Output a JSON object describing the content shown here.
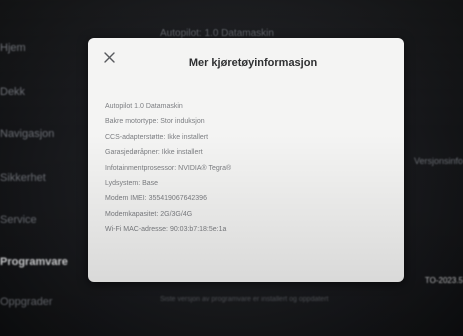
{
  "background": {
    "header_text": "Autopilot: 1.0 Datamaskin",
    "menu_items": [
      {
        "label": "Hjem"
      },
      {
        "label": "Dekk"
      },
      {
        "label": "Navigasjon"
      },
      {
        "label": "Sikkerhet"
      },
      {
        "label": "Service"
      },
      {
        "label": "Programvare"
      },
      {
        "label": "Oppgrader"
      }
    ],
    "right_texts": [
      "Versjonsinfo",
      "TO-2023.5"
    ],
    "footer_text": "Siste versjon av programvare er installert og oppdatert"
  },
  "modal": {
    "title": "Mer kjøretøyinformasjon",
    "close_label": "×",
    "items": [
      {
        "text": "Autopilot 1.0 Datamaskin"
      },
      {
        "text": "Bakre motortype: Stor induksjon"
      },
      {
        "text": "CCS-adapterstøtte: Ikke installert"
      },
      {
        "text": "Garasjedøråpner: Ikke installert"
      },
      {
        "text": "Infotainmentprosessor: NVIDIA® Tegra®"
      },
      {
        "text": "Lydsystem: Base"
      },
      {
        "text": "Modem IMEI: 355419067642396"
      },
      {
        "text": "Modemkapasitet: 2G/3G/4G"
      },
      {
        "text": "Wi-Fi MAC-adresse: 90:03:b7:18:5e:1a"
      }
    ]
  },
  "colors": {
    "modal_background": "#f4f4f3",
    "title_text": "#2b2c2e",
    "item_text": "#7c7e82",
    "screen_background": "#16171a"
  }
}
